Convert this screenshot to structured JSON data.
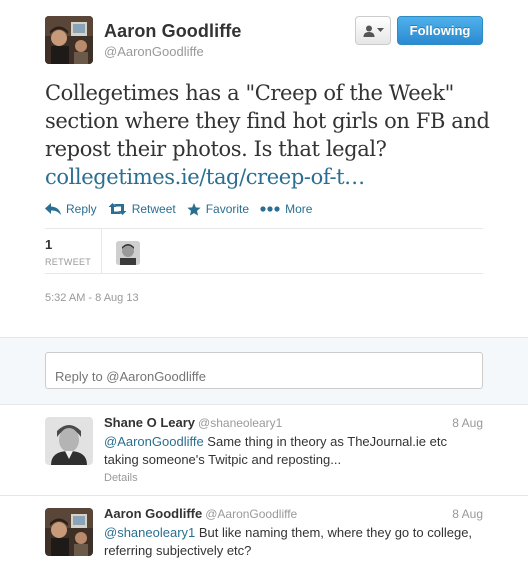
{
  "author": {
    "fullname": "Aaron Goodliffe",
    "screen_name": "@AaronGoodliffe"
  },
  "buttons": {
    "user_actions_icon": "person-icon",
    "follow_label": "Following"
  },
  "tweet": {
    "text": "Collegetimes has a \"Creep of the Week\" section where they find hot girls on FB and repost their photos. Is that legal?",
    "link": "collegetimes.ie/tag/creep-of-t…",
    "actions": [
      {
        "icon": "reply-icon",
        "label": "Reply"
      },
      {
        "icon": "retweet-icon",
        "label": "Retweet"
      },
      {
        "icon": "favorite-icon",
        "label": "Favorite"
      },
      {
        "icon": "more-icon",
        "label": "More"
      }
    ],
    "retweet_count": "1",
    "retweet_label": "RETWEET",
    "timestamp": "5:32 AM - 8 Aug 13"
  },
  "reply_box": {
    "placeholder": "Reply to @AaronGoodliffe"
  },
  "replies": [
    {
      "fullname": "Shane O Leary",
      "screen_name": "@shaneoleary1",
      "date": "8 Aug",
      "mention": "@AaronGoodliffe",
      "text": " Same thing in theory as TheJournal.ie etc taking someone's Twitpic and reposting...",
      "details": "Details"
    },
    {
      "fullname": "Aaron Goodliffe",
      "screen_name": "@AaronGoodliffe",
      "date": "8 Aug",
      "mention": "@shaneoleary1",
      "text": " But like naming them, where they go to college, referring subjectively etc?"
    }
  ],
  "colors": {
    "link": "#2a6f91",
    "follow_button": "#2b8ad0",
    "muted": "#999999",
    "reply_bg": "#f5f8fa"
  }
}
